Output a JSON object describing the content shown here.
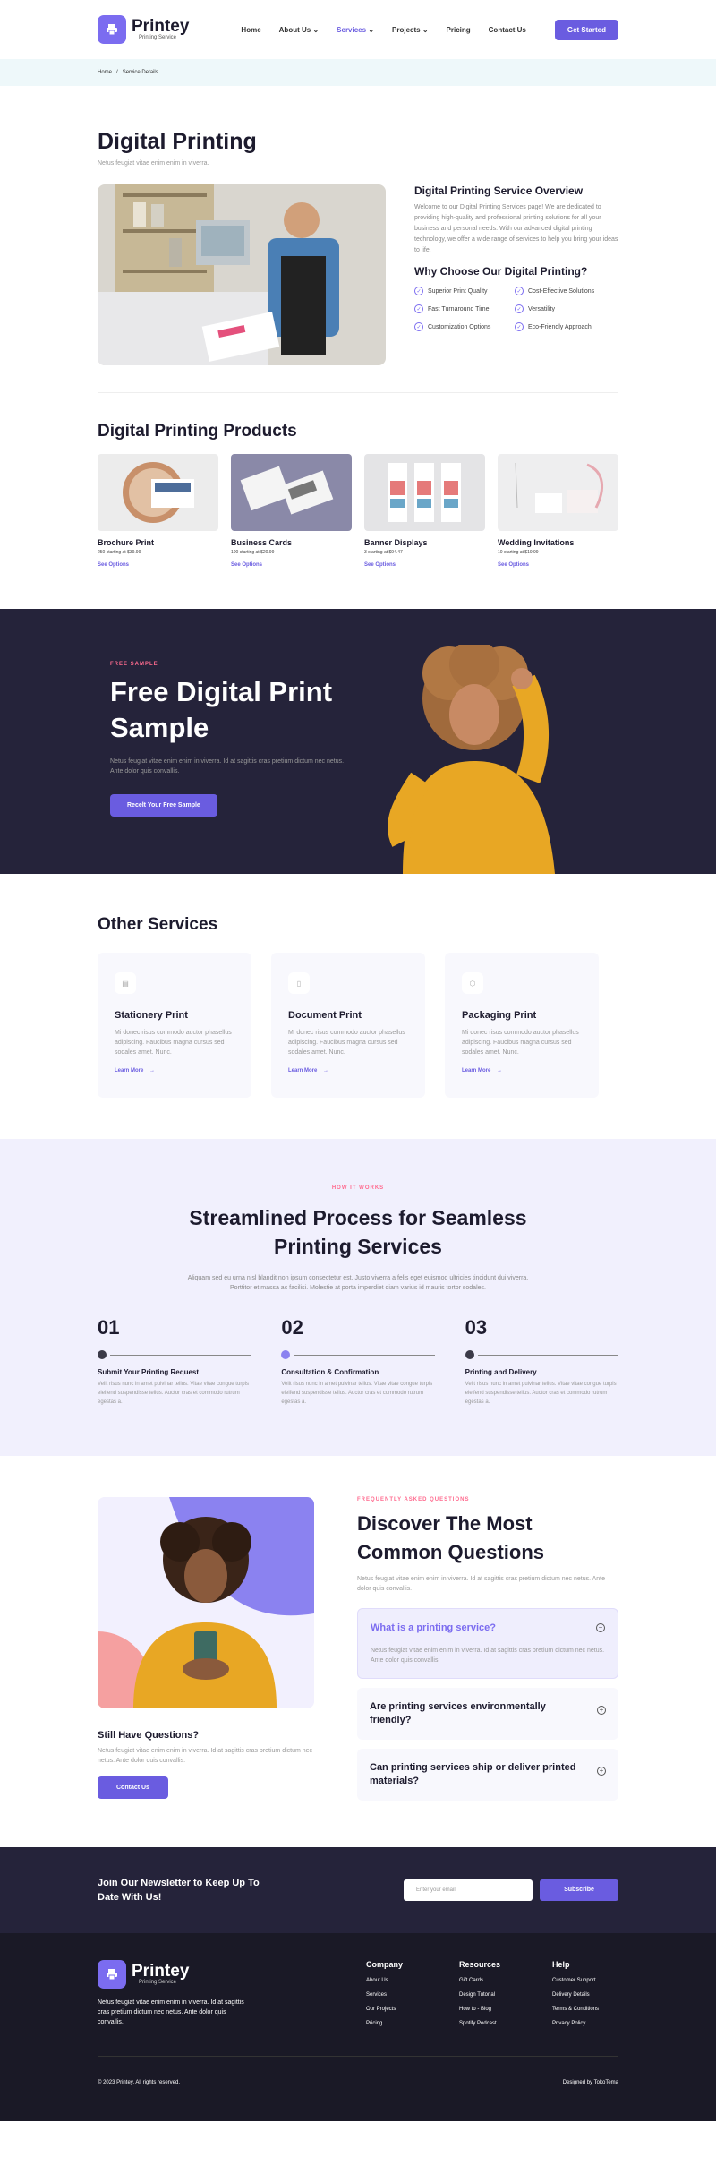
{
  "brand": {
    "name": "Printey",
    "tagline": "Printing Service"
  },
  "nav": {
    "items": [
      "Home",
      "About Us",
      "Services",
      "Projects",
      "Pricing",
      "Contact Us"
    ],
    "active": "Services",
    "cta": "Get Started"
  },
  "breadcrumb": {
    "home": "Home",
    "sep": "/",
    "current": "Service Details"
  },
  "page": {
    "title": "Digital Printing",
    "subtitle": "Netus feugiat vitae enim enim in viverra."
  },
  "overview": {
    "title": "Digital Printing Service Overview",
    "text": "Welcome to our Digital Printing Services page! We are dedicated to providing high-quality and professional printing solutions for all your business and personal needs. With our advanced digital printing technology, we offer a wide range of services to help you bring your ideas to life.",
    "why_title": "Why Choose Our Digital Printing?",
    "features": [
      "Superior Print Quality",
      "Cost-Effective Solutions",
      "Fast Turnaround Time",
      "Versatility",
      "Customization Options",
      "Eco-Friendly Approach"
    ]
  },
  "products": {
    "title": "Digital Printing Products",
    "items": [
      {
        "name": "Brochure Print",
        "price": "250 starting at $39.99",
        "link": "See Options"
      },
      {
        "name": "Business Cards",
        "price": "100 starting at $20.99",
        "link": "See Options"
      },
      {
        "name": "Banner Displays",
        "price": "3 starting at $94.47",
        "link": "See Options"
      },
      {
        "name": "Wedding Invitations",
        "price": "10 starting at $19.99",
        "link": "See Options"
      }
    ]
  },
  "sample": {
    "eyebrow": "FREE SAMPLE",
    "title": "Free Digital Print Sample",
    "text": "Netus feugiat vitae enim enim in viverra. Id at sagittis cras pretium dictum nec netus. Ante dolor quis convallis.",
    "button": "Recelt Your Free Sample"
  },
  "other": {
    "title": "Other Services",
    "items": [
      {
        "name": "Stationery Print",
        "text": "Mi donec risus commodo auctor phasellus adipiscing. Faucibus magna cursus sed sodales amet. Nunc.",
        "link": "Learn More"
      },
      {
        "name": "Document Print",
        "text": "Mi donec risus commodo auctor phasellus adipiscing. Faucibus magna cursus sed sodales amet. Nunc.",
        "link": "Learn More"
      },
      {
        "name": "Packaging Print",
        "text": "Mi donec risus commodo auctor phasellus adipiscing. Faucibus magna cursus sed sodales amet. Nunc.",
        "link": "Learn More"
      }
    ]
  },
  "process": {
    "eyebrow": "HOW IT WORKS",
    "title": "Streamlined Process for Seamless Printing Services",
    "text": "Aliquam sed eu urna nisl blandit non ipsum consectetur est. Justo viverra a felis eget euismod ultricies tincidunt dui viverra. Porttitor et massa ac facilisi. Molestie at porta imperdiet diam varius id mauris tortor sodales.",
    "steps": [
      {
        "num": "01",
        "title": "Submit Your Printing Request",
        "text": "Velit risus nunc in amet pulvinar tellus. Vitae vitae congue turpis eleifend suspendisse tellus. Auctor cras et commodo rutrum egestas a."
      },
      {
        "num": "02",
        "title": "Consultation & Confirmation",
        "text": "Velit risus nunc in amet pulvinar tellus. Vitae vitae congue turpis eleifend suspendisse tellus. Auctor cras et commodo rutrum egestas a."
      },
      {
        "num": "03",
        "title": "Printing and Delivery",
        "text": "Velit risus nunc in amet pulvinar tellus. Vitae vitae congue turpis eleifend suspendisse tellus. Auctor cras et commodo rutrum egestas a."
      }
    ]
  },
  "faq": {
    "eyebrow": "FREQUENTLY ASKED QUESTIONS",
    "title": "Discover The Most Common Questions",
    "text": "Netus feugiat vitae enim enim in viverra. Id at sagittis cras pretium dictum nec netus. Ante dolor quis convallis.",
    "side_title": "Still Have Questions?",
    "side_text": "Netus feugiat vitae enim enim in viverra. Id at sagittis cras pretium dictum nec netus. Ante dolor quis convallis.",
    "side_button": "Contact Us",
    "items": [
      {
        "q": "What is a printing service?",
        "a": "Netus feugiat vitae enim enim in viverra. Id at sagittis cras pretium dictum nec netus. Ante dolor quis convallis."
      },
      {
        "q": "Are printing services environmentally friendly?",
        "a": ""
      },
      {
        "q": "Can printing services ship or deliver printed materials?",
        "a": ""
      }
    ]
  },
  "newsletter": {
    "title": "Join Our Newsletter to Keep Up To Date With Us!",
    "placeholder": "Enter your email",
    "button": "Subscribe"
  },
  "footer": {
    "about": "Netus feugiat vitae enim enim in viverra. Id at sagittis cras pretium dictum nec netus. Ante dolor quis convallis.",
    "columns": [
      {
        "title": "Company",
        "links": [
          "About Us",
          "Services",
          "Our Projects",
          "Pricing"
        ]
      },
      {
        "title": "Resources",
        "links": [
          "Gift Cards",
          "Design Tutorial",
          "How to - Blog",
          "Spotify Podcast"
        ]
      },
      {
        "title": "Help",
        "links": [
          "Customer Support",
          "Delivery Details",
          "Terms & Conditions",
          "Privacy Policy"
        ]
      }
    ],
    "copyright": "© 2023 Printey. All rights reserved.",
    "credit": "Designed by TokoTema"
  },
  "colors": {
    "accent": "#6a5ce0",
    "dark": "#25233a",
    "footer": "#1a1926",
    "pink": "#ff6b8f"
  }
}
